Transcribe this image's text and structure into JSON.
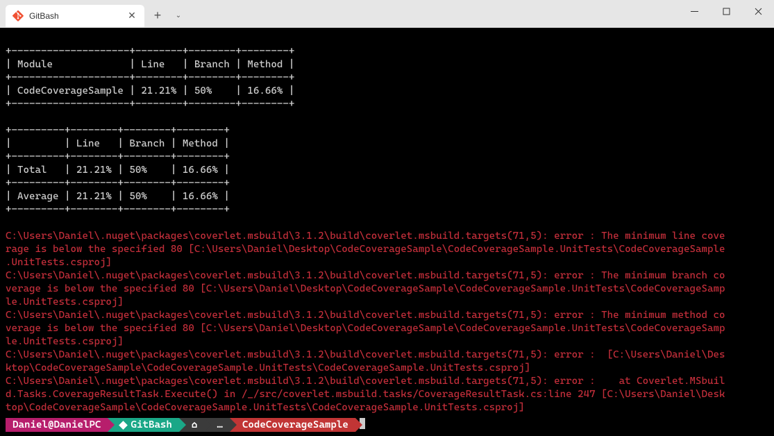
{
  "titlebar": {
    "tab_title": "GitBash",
    "close_glyph": "✕",
    "plus_glyph": "+",
    "chevron_glyph": "⌄"
  },
  "table1": {
    "headers": [
      "Module",
      "Line",
      "Branch",
      "Method"
    ],
    "row": [
      "CodeCoverageSample",
      "21.21%",
      "50%",
      "16.66%"
    ]
  },
  "table2": {
    "headers": [
      "",
      "Line",
      "Branch",
      "Method"
    ],
    "rows": [
      [
        "Total",
        "21.21%",
        "50%",
        "16.66%"
      ],
      [
        "Average",
        "21.21%",
        "50%",
        "16.66%"
      ]
    ]
  },
  "errors": [
    "C:\\Users\\Daniel\\.nuget\\packages\\coverlet.msbuild\\3.1.2\\build\\coverlet.msbuild.targets(71,5): error : The minimum line coverage is below the specified 80 [C:\\Users\\Daniel\\Desktop\\CodeCoverageSample\\CodeCoverageSample.UnitTests\\CodeCoverageSample.UnitTests.csproj]",
    "C:\\Users\\Daniel\\.nuget\\packages\\coverlet.msbuild\\3.1.2\\build\\coverlet.msbuild.targets(71,5): error : The minimum branch coverage is below the specified 80 [C:\\Users\\Daniel\\Desktop\\CodeCoverageSample\\CodeCoverageSample.UnitTests\\CodeCoverageSample.UnitTests.csproj]",
    "C:\\Users\\Daniel\\.nuget\\packages\\coverlet.msbuild\\3.1.2\\build\\coverlet.msbuild.targets(71,5): error : The minimum method coverage is below the specified 80 [C:\\Users\\Daniel\\Desktop\\CodeCoverageSample\\CodeCoverageSample.UnitTests\\CodeCoverageSample.UnitTests.csproj]",
    "C:\\Users\\Daniel\\.nuget\\packages\\coverlet.msbuild\\3.1.2\\build\\coverlet.msbuild.targets(71,5): error :  [C:\\Users\\Daniel\\Desktop\\CodeCoverageSample\\CodeCoverageSample.UnitTests\\CodeCoverageSample.UnitTests.csproj]",
    "C:\\Users\\Daniel\\.nuget\\packages\\coverlet.msbuild\\3.1.2\\build\\coverlet.msbuild.targets(71,5): error :    at Coverlet.MSbuild.Tasks.CoverageResultTask.Execute() in /_/src/coverlet.msbuild.tasks/CoverageResultTask.cs:line 247 [C:\\Users\\Daniel\\Desktop\\CodeCoverageSample\\CodeCoverageSample.UnitTests\\CodeCoverageSample.UnitTests.csproj]"
  ],
  "prompt": {
    "userhost": "Daniel@DanielPC",
    "shell": "GitBash",
    "home": "⌂",
    "sep": "…",
    "dir": "CodeCoverageSample"
  }
}
